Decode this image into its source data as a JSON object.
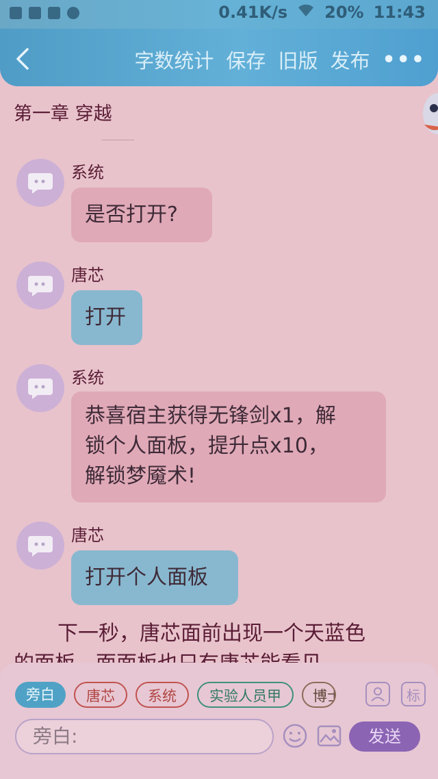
{
  "status_bar": {
    "net_speed": "0.41K/s",
    "battery": "20%",
    "time": "11:43"
  },
  "header": {
    "back_icon": "chevron-left-icon",
    "actions": [
      "字数统计",
      "保存",
      "旧版",
      "发布"
    ],
    "more_icon": "more-dots-icon"
  },
  "chapter": {
    "title": "第一章 穿越"
  },
  "messages": [
    {
      "sender": "系统",
      "text": "是否打开?",
      "color": "#e0a9b7"
    },
    {
      "sender": "唐芯",
      "text": "打开",
      "color": "#88b8cf"
    },
    {
      "sender": "系统",
      "lines": [
        "恭喜宿主获得无锋剑x1，解",
        "锁个人面板，提升点x10，",
        "解锁梦魇术!"
      ],
      "color": "#e0a9b7"
    },
    {
      "sender": "唐芯",
      "text": "打开个人面板",
      "color": "#88b8cf"
    }
  ],
  "narration": {
    "lines": [
      "下一秒，唐芯面前出现一个天蓝色",
      "的面板，面面板也只有唐芯能看见"
    ]
  },
  "composer": {
    "roles": [
      "旁白",
      "唐芯",
      "系统",
      "实验人员甲",
      "博士"
    ],
    "active_role": "旁白",
    "tool_buttons": {
      "profile_icon": "person-icon",
      "tag_label": "标"
    },
    "input_placeholder": "旁白:",
    "emoji_icon": "smile-icon",
    "image_icon": "image-icon",
    "send_label": "发送"
  },
  "colors": {
    "header": "#4f9cc6",
    "accent_send": "#8b64b4",
    "system_bubble": "#e0a9b7",
    "user_bubble": "#88b8cf"
  }
}
